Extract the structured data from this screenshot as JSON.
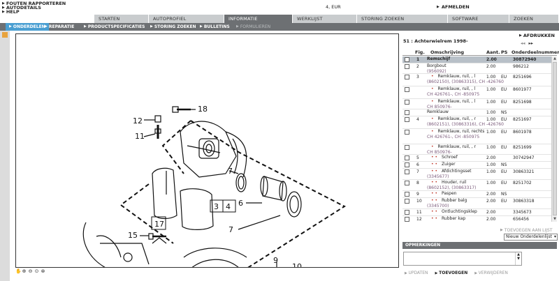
{
  "header": {
    "links": [
      "FOUTEN RAPPORTEREN",
      "AUTODETAILS",
      "HELP"
    ],
    "cart": "4, EUR",
    "logout": "AFMELDEN"
  },
  "tabs": [
    {
      "label": "STARTEN"
    },
    {
      "label": "AUTOPROFIEL"
    },
    {
      "label": "INFORMATIE"
    },
    {
      "label": "WERKLIJST"
    },
    {
      "label": "STORING ZOEKEN"
    },
    {
      "label": "SOFTWARE"
    },
    {
      "label": "ZOEKEN"
    }
  ],
  "subtabs": [
    {
      "label": "ONDERDELEN"
    },
    {
      "label": "REPARATIE"
    },
    {
      "label": "PRODUCTSPECIFICATIES"
    },
    {
      "label": "STORING ZOEKEN"
    },
    {
      "label": "BULLETINS"
    },
    {
      "label": "FORMULIEREN"
    }
  ],
  "drawing": {
    "callouts": [
      "18",
      "12",
      "11",
      "7",
      "6",
      "7",
      "3",
      "4",
      "17",
      "15",
      "9",
      "10"
    ]
  },
  "panel": {
    "print": "AFDRUKKEN",
    "pager_prev": "◂◂",
    "pager_next": "▸▸",
    "section_title": "51 : Achterwielrem 1998-",
    "columns": {
      "fig": "Fig.",
      "desc": "Omschrijving",
      "qty": "Aant.",
      "ps": "PS",
      "pn": "Onderdeelnummer"
    },
    "rows": [
      {
        "fig": "1",
        "desc": "Remschijf",
        "sub": "",
        "qty": "2.00",
        "ps": "",
        "pn": "30872940",
        "dots": "",
        "sel": true
      },
      {
        "fig": "2",
        "desc": "Borgbout",
        "sub": "(956092)",
        "qty": "2.00",
        "ps": "",
        "pn": "986212",
        "dots": ""
      },
      {
        "fig": "3",
        "desc": "Remklauw, ruil, , l",
        "sub": "(8602150), (30863315), CH -426760",
        "qty": "1.00",
        "ps": "EU",
        "pn": "8251696",
        "dots": "•"
      },
      {
        "fig": "",
        "desc": "Remklauw, ruil, , l",
        "sub": "CH 426761-, CH -850975",
        "qty": "1.00",
        "ps": "EU",
        "pn": "8601977",
        "dots": "•"
      },
      {
        "fig": "",
        "desc": "Remklauw, ruil, , l",
        "sub": "CH 850976-",
        "qty": "1.00",
        "ps": "EU",
        "pn": "8251698",
        "dots": "•"
      },
      {
        "fig": "",
        "desc": "Remklauw",
        "sub": "",
        "qty": "1.00",
        "ps": "NS",
        "pn": "",
        "dots": ""
      },
      {
        "fig": "4",
        "desc": "Remklauw, ruil, , r",
        "sub": "(8602151), (30863316), CH -426760",
        "qty": "1.00",
        "ps": "EU",
        "pn": "8251697",
        "dots": "•"
      },
      {
        "fig": "",
        "desc": "Remklauw, ruil, rechts",
        "sub": "CH 426761-, CH -850975",
        "qty": "1.00",
        "ps": "EU",
        "pn": "8601978",
        "dots": "•"
      },
      {
        "fig": "",
        "desc": "Remklauw, ruil, , r",
        "sub": "CH 850976-",
        "qty": "1.00",
        "ps": "EU",
        "pn": "8251699",
        "dots": "•"
      },
      {
        "fig": "5",
        "desc": "Schroef",
        "sub": "",
        "qty": "2.00",
        "ps": "",
        "pn": "30742947",
        "dots": "• •"
      },
      {
        "fig": "6",
        "desc": "Zuiger",
        "sub": "",
        "qty": "1.00",
        "ps": "NS",
        "pn": "",
        "dots": "• •"
      },
      {
        "fig": "7",
        "desc": "Afdichtingsset",
        "sub": "(3345677)",
        "qty": "1.00",
        "ps": "EU",
        "pn": "30863321",
        "dots": "• •"
      },
      {
        "fig": "8",
        "desc": "Houder, ruil",
        "sub": "(8602152), (30863317)",
        "qty": "1.00",
        "ps": "EU",
        "pn": "8251702",
        "dots": "• •"
      },
      {
        "fig": "9",
        "desc": "Paspen",
        "sub": "",
        "qty": "2.00",
        "ps": "NS",
        "pn": "",
        "dots": "• •"
      },
      {
        "fig": "10",
        "desc": "Rubber balg",
        "sub": "(3345700)",
        "qty": "2.00",
        "ps": "EU",
        "pn": "30863318",
        "dots": "• •"
      },
      {
        "fig": "11",
        "desc": "Ontluchtingsklep",
        "sub": "",
        "qty": "2.00",
        "ps": "",
        "pn": "3345673",
        "dots": "• •"
      },
      {
        "fig": "12",
        "desc": "Rubber kap",
        "sub": "",
        "qty": "2.00",
        "ps": "",
        "pn": "656456",
        "dots": "• •"
      }
    ],
    "add_to_list": "TOEVOEGEN AAN LIJST",
    "list_select": "Nieuw Onderdelenlijst",
    "notes_header": "OPMERKINGEN",
    "actions": [
      "UPDATEN",
      "TOEVOEGEN",
      "VERWIJDEREN"
    ]
  },
  "colors": {
    "tab_active": "#6d7073",
    "subtab_active": "#4a9fd2",
    "selected_row": "#b8c0c8"
  }
}
